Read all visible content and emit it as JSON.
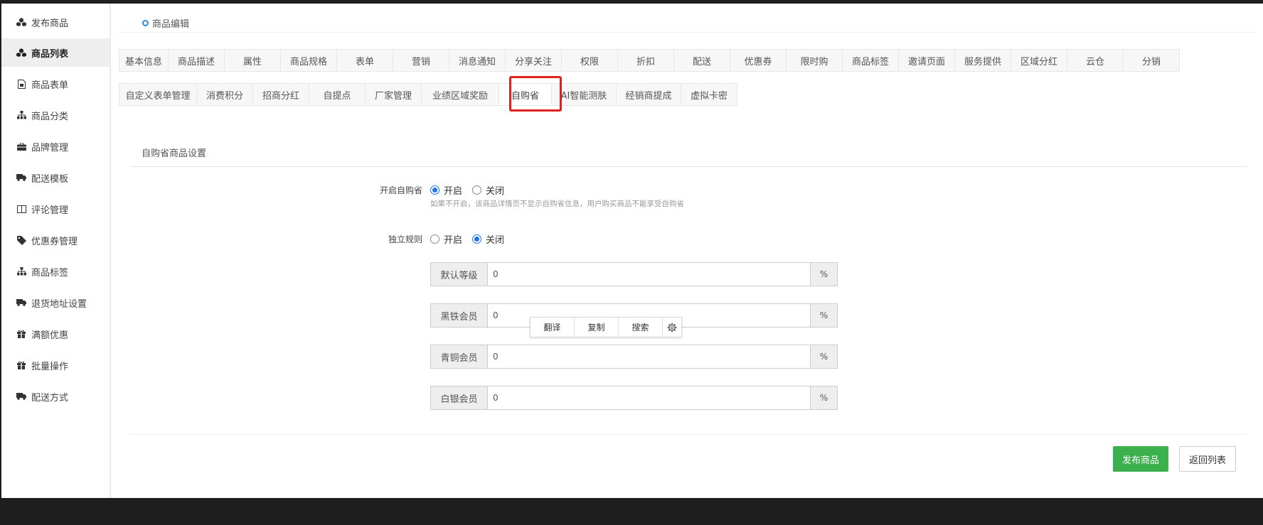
{
  "sidebar": {
    "items": [
      {
        "label": "发布商品",
        "icon": "cubes-icon"
      },
      {
        "label": "商品列表",
        "icon": "cubes-icon",
        "active": true
      },
      {
        "label": "商品表单",
        "icon": "file-icon"
      },
      {
        "label": "商品分类",
        "icon": "sitemap-icon"
      },
      {
        "label": "品牌管理",
        "icon": "briefcase-icon"
      },
      {
        "label": "配送模板",
        "icon": "truck-icon"
      },
      {
        "label": "评论管理",
        "icon": "columns-icon"
      },
      {
        "label": "优惠券管理",
        "icon": "tag-icon"
      },
      {
        "label": "商品标签",
        "icon": "sitemap-icon"
      },
      {
        "label": "退货地址设置",
        "icon": "truck-icon"
      },
      {
        "label": "满额优惠",
        "icon": "gift-icon"
      },
      {
        "label": "批量操作",
        "icon": "gift-icon"
      },
      {
        "label": "配送方式",
        "icon": "truck-icon"
      }
    ]
  },
  "breadcrumb": {
    "label": "商品编辑"
  },
  "tabs_row1": [
    "基本信息",
    "商品描述",
    "属性",
    "商品规格",
    "表单",
    "营销",
    "消息通知",
    "分享关注",
    "权限",
    "折扣",
    "配送",
    "优惠券",
    "限时购",
    "商品标签",
    "邀请页面",
    "服务提供",
    "区域分红",
    "云仓",
    "分销"
  ],
  "tabs_row2": [
    "自定义表单管理",
    "消费积分",
    "招商分红",
    "自提点",
    "厂家管理",
    "业绩区域奖励",
    "自购省",
    "AI智能测肤",
    "经销商提成",
    "虚拟卡密"
  ],
  "active_tab": "自购省",
  "section_title": "自购省商品设置",
  "form": {
    "enable": {
      "label": "开启自购省",
      "options": [
        "开启",
        "关闭"
      ],
      "selected": "开启",
      "hint": "如果不开启，该商品详情页不显示自购省信息，用户购买商品不能享受自购省"
    },
    "independent_rule": {
      "label": "独立规则",
      "options": [
        "开启",
        "关闭"
      ],
      "selected": "关闭"
    },
    "levels": [
      {
        "name": "默认等级",
        "value": "0",
        "unit": "%"
      },
      {
        "name": "黑铁会员",
        "value": "0",
        "unit": "%"
      },
      {
        "name": "青铜会员",
        "value": "0",
        "unit": "%"
      },
      {
        "name": "白银会员",
        "value": "0",
        "unit": "%"
      }
    ]
  },
  "context_menu": {
    "translate": "翻译",
    "copy": "复制",
    "search": "搜索",
    "settings_icon": "gear-icon"
  },
  "buttons": {
    "publish": "发布商品",
    "back": "返回列表"
  },
  "colors": {
    "accent_blue": "#1a73e8",
    "publish_green": "#3cb04d",
    "highlight_red": "#e02020"
  }
}
